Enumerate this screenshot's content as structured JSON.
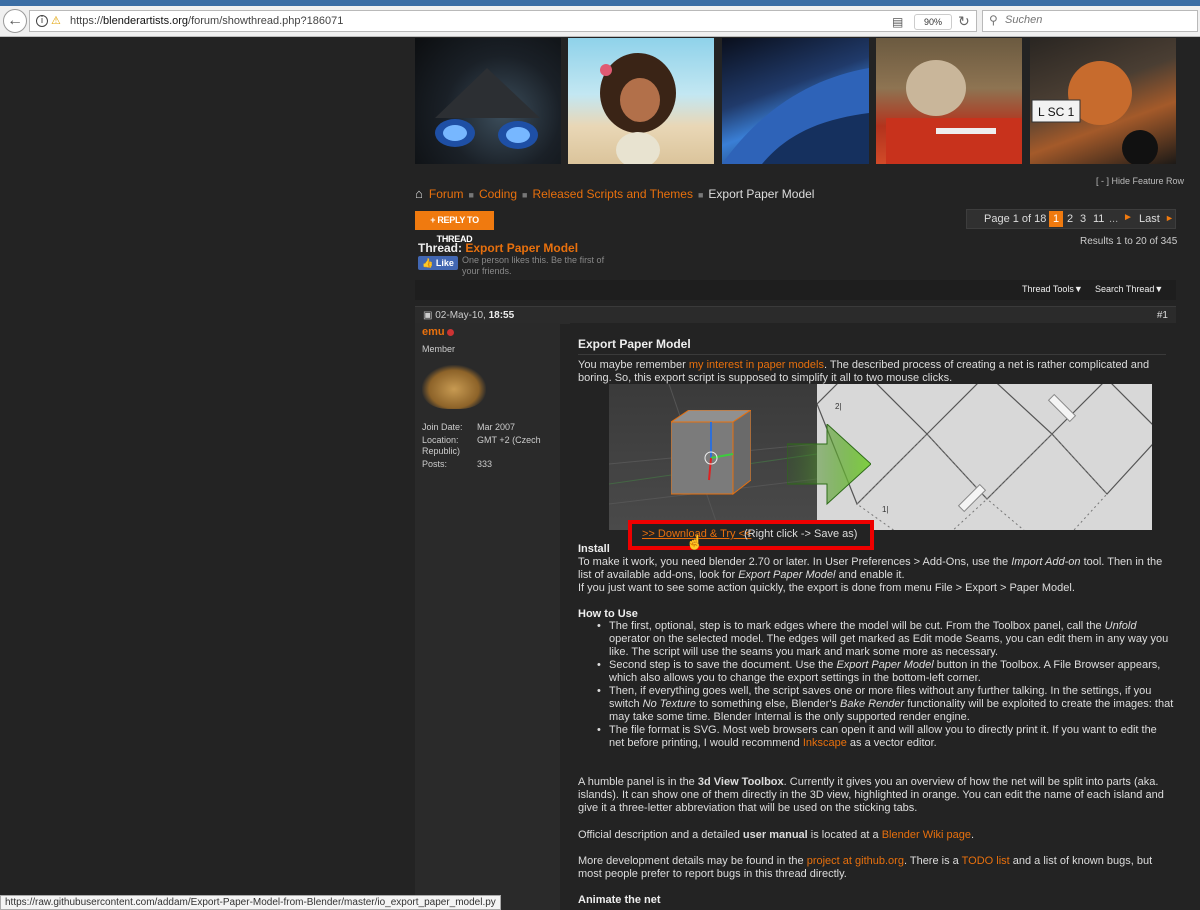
{
  "browser": {
    "url_prefix": "https://",
    "url_domain": "blenderartists.org",
    "url_path": "/forum/showthread.php?186071",
    "zoom": "90%",
    "search_placeholder": "Suchen"
  },
  "feature": {
    "hide_label": "[ - ] Hide Feature Row"
  },
  "breadcrumb": {
    "items": [
      "Forum",
      "Coding",
      "Released Scripts and Themes",
      "Export Paper Model"
    ]
  },
  "reply_button": "+ REPLY TO THREAD",
  "pagination": {
    "label": "Page 1 of 18",
    "current": "1",
    "pages": [
      "2",
      "3",
      "11"
    ],
    "ellipsis": "...",
    "next": "►",
    "last": "Last",
    "last_arrow": "►"
  },
  "results": "Results 1 to 20 of 345",
  "thread": {
    "prefix": "Thread:",
    "title": "Export Paper Model",
    "like_label": "Like",
    "like_text": "One person likes this. Be the first of your friends."
  },
  "tools": {
    "thread_tools": "Thread Tools▼",
    "search_thread": "Search Thread▼"
  },
  "post": {
    "date": "02-May-10,",
    "time": "18:55",
    "number": "#1",
    "author": "emu",
    "user_title": "Member",
    "userinfo": [
      {
        "k": "Join Date:",
        "v": "Mar 2007"
      },
      {
        "k": "Location:",
        "v": "GMT +2 (Czech Republic)"
      },
      {
        "k": "Posts:",
        "v": "333"
      }
    ],
    "title": "Export Paper Model",
    "intro_a": "You maybe remember ",
    "intro_link": "my interest in paper models",
    "intro_b": ". The described process of creating a net is rather complicated and boring. So, this export script is supposed to simplify it all to two mouse clicks.",
    "download_link": ">> Download & Try <<",
    "download_tail": "(Right click -> Save as)",
    "install_heading": "Install",
    "install_1a": "To make it work, you need blender 2.70 or later. In User Preferences > Add-Ons, use the ",
    "install_1i": "Import Add-on",
    "install_1b": " tool. Then in the list of available add-ons, look for ",
    "install_1i2": "Export Paper Model",
    "install_1c": " and enable it.",
    "install_2": "If you just want to see some action quickly, the export is done from menu File > Export > Paper Model.",
    "howto_heading": "How to Use",
    "howto_1a": "The first, optional, step is to mark edges where the model will be cut. From the Toolbox panel, call the ",
    "howto_1i": "Unfold",
    "howto_1b": " operator on the selected model. The edges will get marked as Edit mode Seams, you can edit them in any way you like. The script will use the seams you mark and mark some more as necessary.",
    "howto_2a": "Second step is to save the document. Use the ",
    "howto_2i": "Export Paper Model",
    "howto_2b": " button in the Toolbox. A File Browser appears, which also allows you to change the export settings in the bottom-left corner.",
    "howto_3a": "Then, if everything goes well, the script saves one or more files without any further talking. In the settings, if you switch ",
    "howto_3i": "No Texture",
    "howto_3b": " to something else, Blender's ",
    "howto_3i2": "Bake Render",
    "howto_3c": " functionality will be exploited to create the images: that may take some time. Blender Internal is the only supported render engine.",
    "howto_4a": "The file format is SVG. Most web browsers can open it and will allow you to directly print it. If you want to edit the net before printing, I would recommend ",
    "howto_4link": "Inkscape",
    "howto_4b": " as a vector editor.",
    "panel_a": "A humble panel is in the ",
    "panel_b": "3d View Toolbox",
    "panel_c": ". Currently it gives you an overview of how the net will be split into parts (aka. islands). It can show one of them directly in the 3D view, highlighted in orange. You can edit the name of each island and give it a three-letter abbreviation that will be used on the sticking tabs.",
    "official_a": "Official description and a detailed ",
    "official_b": "user manual",
    "official_c": " is located at a ",
    "official_link": "Blender Wiki page",
    "official_d": ".",
    "dev_a": "More development details may be found in the ",
    "dev_link1": "project at github.org",
    "dev_b": ". There is a ",
    "dev_link2": "TODO list",
    "dev_c": " and a list of known bugs, but most people prefer to report bugs in this thread directly.",
    "animate_heading": "Animate the net"
  },
  "statusbar": "https://raw.githubusercontent.com/addam/Export-Paper-Model-from-Blender/master/io_export_paper_model.py"
}
